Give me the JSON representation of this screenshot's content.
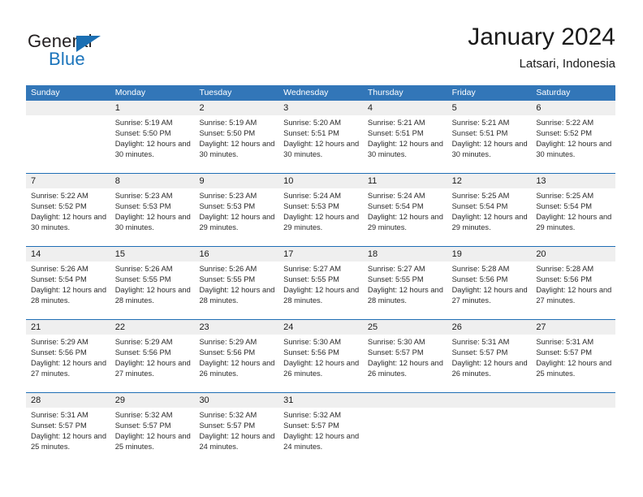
{
  "brand": {
    "name_part1": "General",
    "name_part2": "Blue",
    "triangle_icon": "triangle-icon",
    "color_dark": "#231f20",
    "color_blue": "#1b74bb"
  },
  "header": {
    "title": "January 2024",
    "location": "Latsari, Indonesia"
  },
  "colors": {
    "header_blue": "#3276b8",
    "divider_blue": "#1f6eb5",
    "daynum_band": "#efefef",
    "text": "#2b2b2b"
  },
  "weekdays": [
    "Sunday",
    "Monday",
    "Tuesday",
    "Wednesday",
    "Thursday",
    "Friday",
    "Saturday"
  ],
  "weeks": [
    {
      "daynums": [
        "",
        "1",
        "2",
        "3",
        "4",
        "5",
        "6"
      ],
      "cells": [
        {
          "empty": true
        },
        {
          "sunrise": "Sunrise: 5:19 AM",
          "sunset": "Sunset: 5:50 PM",
          "daylight": "Daylight: 12 hours and 30 minutes."
        },
        {
          "sunrise": "Sunrise: 5:19 AM",
          "sunset": "Sunset: 5:50 PM",
          "daylight": "Daylight: 12 hours and 30 minutes."
        },
        {
          "sunrise": "Sunrise: 5:20 AM",
          "sunset": "Sunset: 5:51 PM",
          "daylight": "Daylight: 12 hours and 30 minutes."
        },
        {
          "sunrise": "Sunrise: 5:21 AM",
          "sunset": "Sunset: 5:51 PM",
          "daylight": "Daylight: 12 hours and 30 minutes."
        },
        {
          "sunrise": "Sunrise: 5:21 AM",
          "sunset": "Sunset: 5:51 PM",
          "daylight": "Daylight: 12 hours and 30 minutes."
        },
        {
          "sunrise": "Sunrise: 5:22 AM",
          "sunset": "Sunset: 5:52 PM",
          "daylight": "Daylight: 12 hours and 30 minutes."
        }
      ]
    },
    {
      "daynums": [
        "7",
        "8",
        "9",
        "10",
        "11",
        "12",
        "13"
      ],
      "cells": [
        {
          "sunrise": "Sunrise: 5:22 AM",
          "sunset": "Sunset: 5:52 PM",
          "daylight": "Daylight: 12 hours and 30 minutes."
        },
        {
          "sunrise": "Sunrise: 5:23 AM",
          "sunset": "Sunset: 5:53 PM",
          "daylight": "Daylight: 12 hours and 30 minutes."
        },
        {
          "sunrise": "Sunrise: 5:23 AM",
          "sunset": "Sunset: 5:53 PM",
          "daylight": "Daylight: 12 hours and 29 minutes."
        },
        {
          "sunrise": "Sunrise: 5:24 AM",
          "sunset": "Sunset: 5:53 PM",
          "daylight": "Daylight: 12 hours and 29 minutes."
        },
        {
          "sunrise": "Sunrise: 5:24 AM",
          "sunset": "Sunset: 5:54 PM",
          "daylight": "Daylight: 12 hours and 29 minutes."
        },
        {
          "sunrise": "Sunrise: 5:25 AM",
          "sunset": "Sunset: 5:54 PM",
          "daylight": "Daylight: 12 hours and 29 minutes."
        },
        {
          "sunrise": "Sunrise: 5:25 AM",
          "sunset": "Sunset: 5:54 PM",
          "daylight": "Daylight: 12 hours and 29 minutes."
        }
      ]
    },
    {
      "daynums": [
        "14",
        "15",
        "16",
        "17",
        "18",
        "19",
        "20"
      ],
      "cells": [
        {
          "sunrise": "Sunrise: 5:26 AM",
          "sunset": "Sunset: 5:54 PM",
          "daylight": "Daylight: 12 hours and 28 minutes."
        },
        {
          "sunrise": "Sunrise: 5:26 AM",
          "sunset": "Sunset: 5:55 PM",
          "daylight": "Daylight: 12 hours and 28 minutes."
        },
        {
          "sunrise": "Sunrise: 5:26 AM",
          "sunset": "Sunset: 5:55 PM",
          "daylight": "Daylight: 12 hours and 28 minutes."
        },
        {
          "sunrise": "Sunrise: 5:27 AM",
          "sunset": "Sunset: 5:55 PM",
          "daylight": "Daylight: 12 hours and 28 minutes."
        },
        {
          "sunrise": "Sunrise: 5:27 AM",
          "sunset": "Sunset: 5:55 PM",
          "daylight": "Daylight: 12 hours and 28 minutes."
        },
        {
          "sunrise": "Sunrise: 5:28 AM",
          "sunset": "Sunset: 5:56 PM",
          "daylight": "Daylight: 12 hours and 27 minutes."
        },
        {
          "sunrise": "Sunrise: 5:28 AM",
          "sunset": "Sunset: 5:56 PM",
          "daylight": "Daylight: 12 hours and 27 minutes."
        }
      ]
    },
    {
      "daynums": [
        "21",
        "22",
        "23",
        "24",
        "25",
        "26",
        "27"
      ],
      "cells": [
        {
          "sunrise": "Sunrise: 5:29 AM",
          "sunset": "Sunset: 5:56 PM",
          "daylight": "Daylight: 12 hours and 27 minutes."
        },
        {
          "sunrise": "Sunrise: 5:29 AM",
          "sunset": "Sunset: 5:56 PM",
          "daylight": "Daylight: 12 hours and 27 minutes."
        },
        {
          "sunrise": "Sunrise: 5:29 AM",
          "sunset": "Sunset: 5:56 PM",
          "daylight": "Daylight: 12 hours and 26 minutes."
        },
        {
          "sunrise": "Sunrise: 5:30 AM",
          "sunset": "Sunset: 5:56 PM",
          "daylight": "Daylight: 12 hours and 26 minutes."
        },
        {
          "sunrise": "Sunrise: 5:30 AM",
          "sunset": "Sunset: 5:57 PM",
          "daylight": "Daylight: 12 hours and 26 minutes."
        },
        {
          "sunrise": "Sunrise: 5:31 AM",
          "sunset": "Sunset: 5:57 PM",
          "daylight": "Daylight: 12 hours and 26 minutes."
        },
        {
          "sunrise": "Sunrise: 5:31 AM",
          "sunset": "Sunset: 5:57 PM",
          "daylight": "Daylight: 12 hours and 25 minutes."
        }
      ]
    },
    {
      "daynums": [
        "28",
        "29",
        "30",
        "31",
        "",
        "",
        ""
      ],
      "cells": [
        {
          "sunrise": "Sunrise: 5:31 AM",
          "sunset": "Sunset: 5:57 PM",
          "daylight": "Daylight: 12 hours and 25 minutes."
        },
        {
          "sunrise": "Sunrise: 5:32 AM",
          "sunset": "Sunset: 5:57 PM",
          "daylight": "Daylight: 12 hours and 25 minutes."
        },
        {
          "sunrise": "Sunrise: 5:32 AM",
          "sunset": "Sunset: 5:57 PM",
          "daylight": "Daylight: 12 hours and 24 minutes."
        },
        {
          "sunrise": "Sunrise: 5:32 AM",
          "sunset": "Sunset: 5:57 PM",
          "daylight": "Daylight: 12 hours and 24 minutes."
        },
        {
          "empty": true
        },
        {
          "empty": true
        },
        {
          "empty": true
        }
      ]
    }
  ]
}
